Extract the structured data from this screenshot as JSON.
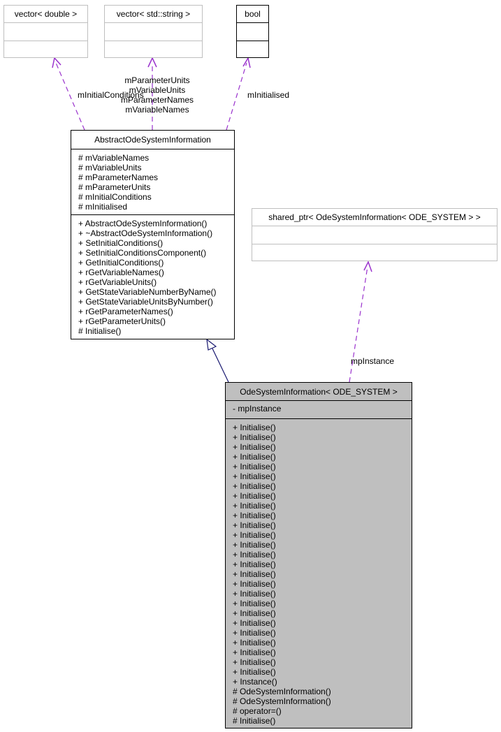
{
  "classes": {
    "vector_double": {
      "title": "vector< double >"
    },
    "vector_string": {
      "title": "vector< std::string >"
    },
    "bool": {
      "title": "bool"
    },
    "shared_ptr": {
      "title": "shared_ptr< OdeSystemInformation< ODE_SYSTEM > >"
    },
    "abstract": {
      "title": "AbstractOdeSystemInformation",
      "attributes": [
        "# mVariableNames",
        "# mVariableUnits",
        "# mParameterNames",
        "# mParameterUnits",
        "# mInitialConditions",
        "# mInitialised"
      ],
      "methods": [
        "+ AbstractOdeSystemInformation()",
        "+ ~AbstractOdeSystemInformation()",
        "+ SetInitialConditions()",
        "+ SetInitialConditionsComponent()",
        "+ GetInitialConditions()",
        "+ rGetVariableNames()",
        "+ rGetVariableUnits()",
        "+ GetStateVariableNumberByName()",
        "+ GetStateVariableUnitsByNumber()",
        "+ rGetParameterNames()",
        "+ rGetParameterUnits()",
        "# Initialise()"
      ]
    },
    "ode": {
      "title": "OdeSystemInformation< ODE_SYSTEM >",
      "attributes": [
        "- mpInstance"
      ],
      "methods": [
        "+ Initialise()",
        "+ Initialise()",
        "+ Initialise()",
        "+ Initialise()",
        "+ Initialise()",
        "+ Initialise()",
        "+ Initialise()",
        "+ Initialise()",
        "+ Initialise()",
        "+ Initialise()",
        "+ Initialise()",
        "+ Initialise()",
        "+ Initialise()",
        "+ Initialise()",
        "+ Initialise()",
        "+ Initialise()",
        "+ Initialise()",
        "+ Initialise()",
        "+ Initialise()",
        "+ Initialise()",
        "+ Initialise()",
        "+ Initialise()",
        "+ Initialise()",
        "+ Initialise()",
        "+ Initialise()",
        "+ Initialise()",
        "+ Instance()",
        "# OdeSystemInformation()",
        "# OdeSystemInformation()",
        "# operator=()",
        "# Initialise()"
      ]
    }
  },
  "edge_labels": {
    "initial_conditions": "mInitialConditions",
    "string_members": [
      "mParameterUnits",
      "mVariableUnits",
      "mParameterNames",
      "mVariableNames"
    ],
    "initialised": "mInitialised",
    "instance": "mpInstance"
  },
  "colors": {
    "usage_edge": "#9a32cd",
    "inheritance_edge": "#191970",
    "focus_fill": "#bfbfbf",
    "undocumented_border": "#bfbfbf"
  }
}
